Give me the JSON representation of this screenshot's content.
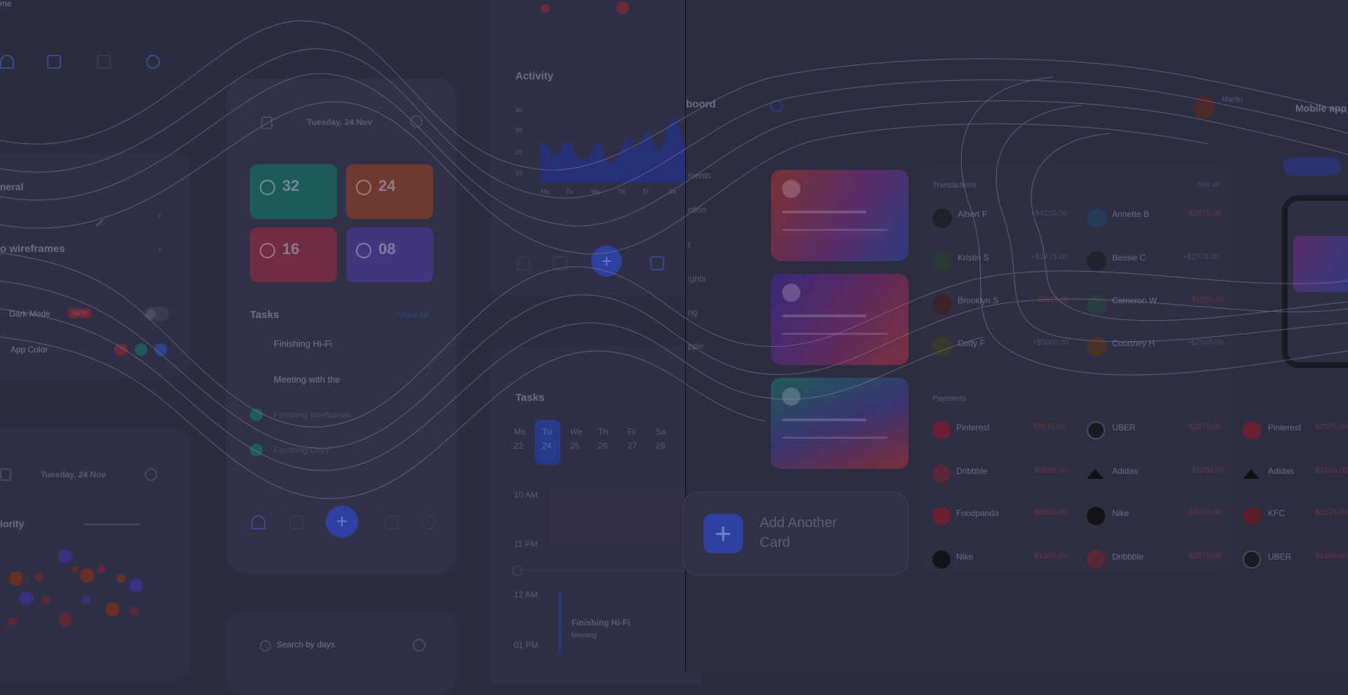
{
  "colors": {
    "background": "#2c2c41",
    "accent_blue": "#3b4fc8",
    "teal": "#1f5a5a",
    "orange": "#7a3b2e",
    "red": "#7c2e44",
    "purple": "#4a3a8c"
  },
  "settings_panel": {
    "general_label": "neral",
    "wireframes_label": "o wireframes",
    "dark_mode_label": "Dark Mode",
    "dark_mode_badge": "NEW",
    "app_color_label": "App Color"
  },
  "priority_panel": {
    "date": "Tuesday, 24 Nov",
    "title": "iority"
  },
  "task_panel": {
    "date": "Tuesday, 24 Nov",
    "tiles": [
      {
        "value": "32"
      },
      {
        "value": "24"
      },
      {
        "value": "16"
      },
      {
        "value": "08"
      }
    ],
    "tasks_title": "Tasks",
    "view_all": "View All",
    "tasks": [
      {
        "name": "Finishing Hi-Fi"
      },
      {
        "name": "Meeting with the"
      },
      {
        "name": "Finishing wireframes"
      },
      {
        "name": "Finishing Copy"
      }
    ],
    "search_placeholder": "Search by days"
  },
  "activity_panel": {
    "title": "Activity",
    "days": [
      "Mo",
      "Tu",
      "We",
      "Th",
      "Fr",
      "Sa"
    ],
    "y_ticks": [
      "40",
      "30",
      "20",
      "10"
    ]
  },
  "calendar_panel": {
    "title": "Tasks",
    "days": [
      {
        "name": "Mo",
        "date": "22"
      },
      {
        "name": "Tu",
        "date": "24"
      },
      {
        "name": "We",
        "date": "25"
      },
      {
        "name": "Th",
        "date": "26"
      },
      {
        "name": "Fr",
        "date": "27"
      },
      {
        "name": "Sa",
        "date": "28"
      }
    ],
    "time_1": "10 AM",
    "time_2": "11 PM",
    "time_3": "12 AM",
    "time_4": "01 PM",
    "event_1": "Finishing Hi-Fi",
    "event_1_sub": "Meeting"
  },
  "dashboard": {
    "brand": "boord",
    "user_name": "Marlin",
    "mobile_label": "Mobile app",
    "add_card_label_1": "Add Another",
    "add_card_label_2": "Card",
    "transactions_title": "Transactions",
    "see_all": "See all",
    "transactions": [
      {
        "name": "Albert F",
        "amount": "+$4250.00",
        "sign": "pos"
      },
      {
        "name": "Annette B",
        "amount": "-$2575.00",
        "sign": "neg"
      },
      {
        "name": "Kristin S",
        "amount": "+$3475.00",
        "sign": "pos"
      },
      {
        "name": "Bessie C",
        "amount": "+$2575.00",
        "sign": "pos"
      },
      {
        "name": "Brooklyn S",
        "amount": "-$2475.00",
        "sign": "neg"
      },
      {
        "name": "Cameron W",
        "amount": "-$1550.00",
        "sign": "neg"
      },
      {
        "name": "Cody F",
        "amount": "+$5000.00",
        "sign": "pos"
      },
      {
        "name": "Courtney H",
        "amount": "+$2500.00",
        "sign": "pos"
      }
    ],
    "payments_title": "Payments",
    "payments": [
      {
        "name": "Pinterest",
        "amount": "-$2575.00"
      },
      {
        "name": "UBER",
        "amount": "-$2575.00"
      },
      {
        "name": "Pinterest",
        "amount": "-$2575.00"
      },
      {
        "name": "Dribbble",
        "amount": "-$3695.00"
      },
      {
        "name": "Adidas",
        "amount": "-$1050.00"
      },
      {
        "name": "Adidas",
        "amount": "-$1050.00"
      },
      {
        "name": "Foodpanda",
        "amount": "-$3505.00"
      },
      {
        "name": "Nike",
        "amount": "-$3075.00"
      },
      {
        "name": "KFC",
        "amount": "-$2575.00"
      },
      {
        "name": "Nike",
        "amount": "-$1005.00"
      },
      {
        "name": "Dribbble",
        "amount": "-$2575.00"
      },
      {
        "name": "UBER",
        "amount": "-$1050.00"
      }
    ],
    "sidebar_items": [
      "ments",
      "ntion",
      "t",
      "ights",
      "ng",
      "pple"
    ]
  }
}
